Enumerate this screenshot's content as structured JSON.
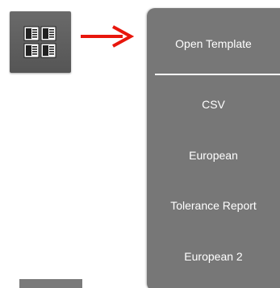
{
  "launcher": {
    "icon": "document-grid-icon"
  },
  "menu": {
    "items": [
      {
        "label": "Open Template"
      },
      {
        "label": "CSV"
      },
      {
        "label": "European"
      },
      {
        "label": "Tolerance Report"
      },
      {
        "label": "European 2"
      }
    ]
  },
  "colors": {
    "panel": "#777777",
    "arrow": "#e8160c",
    "button": "#5f5f5f"
  }
}
